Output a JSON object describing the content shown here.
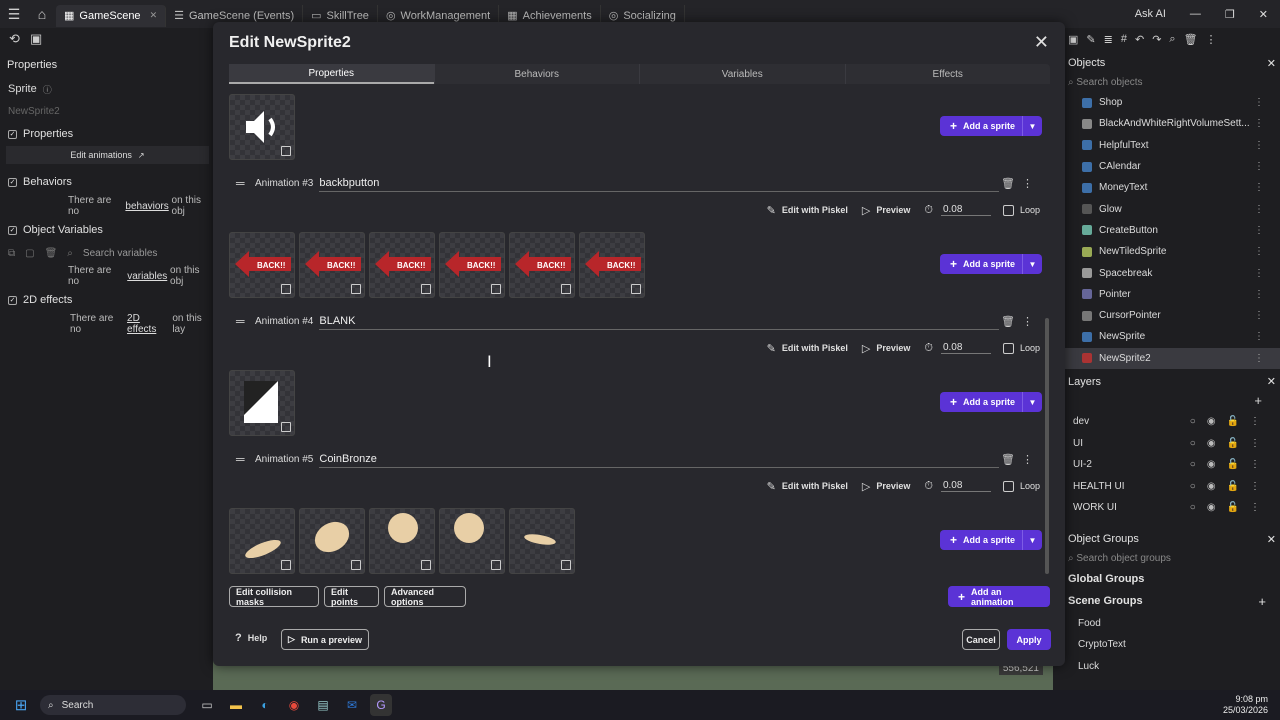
{
  "app": {
    "tabs": [
      {
        "label": "GameScene",
        "active": true
      },
      {
        "label": "GameScene (Events)"
      },
      {
        "label": "SkillTree"
      },
      {
        "label": "WorkManagement"
      },
      {
        "label": "Achievements"
      },
      {
        "label": "Socializing"
      }
    ],
    "ask_ai": "Ask AI"
  },
  "left_panel": {
    "title": "Properties",
    "object_type": "Sprite",
    "name_value": "NewSprite2",
    "sections": {
      "properties": "Properties",
      "edit_animations": "Edit animations",
      "behaviors": "Behaviors",
      "behaviors_empty_pre": "There are no",
      "behaviors_empty_link": "behaviors",
      "behaviors_empty_post": "on this obj",
      "object_variables": "Object Variables",
      "search_variables": "Search variables",
      "vars_empty_pre": "There are no",
      "vars_empty_link": "variables",
      "vars_empty_post": "on this obj",
      "effects_2d": "2D effects",
      "effects_empty_pre": "There are no",
      "effects_empty_link": "2D effects",
      "effects_empty_post": "on this lay"
    }
  },
  "right_panel": {
    "objects_title": "Objects",
    "search_objects": "Search objects",
    "objects": [
      "Shop",
      "BlackAndWhiteRightVolumeSett...",
      "HelpfulText",
      "CAlendar",
      "MoneyText",
      "Glow",
      "CreateButton",
      "NewTiledSprite",
      "Spacebreak",
      "Pointer",
      "CursorPointer",
      "NewSprite",
      "NewSprite2"
    ],
    "layers_title": "Layers",
    "layers": [
      "dev",
      "UI",
      "UI-2",
      "HEALTH UI",
      "WORK UI"
    ],
    "groups_title": "Object Groups",
    "search_groups": "Search object groups",
    "global_groups": "Global Groups",
    "scene_groups": "Scene Groups",
    "groups": [
      "Food",
      "CryptoText",
      "Luck"
    ]
  },
  "modal": {
    "title": "Edit NewSprite2",
    "tabs": [
      "Properties",
      "Behaviors",
      "Variables",
      "Effects"
    ],
    "animations": [
      {
        "label": "Animation #3",
        "name": "backbputton"
      },
      {
        "label": "Animation #4",
        "name": "BLANK"
      },
      {
        "label": "Animation #5",
        "name": "CoinBronze"
      }
    ],
    "back_text": "BACK!!",
    "edit_piskel": "Edit with Piskel",
    "preview": "Preview",
    "fps": "0.08",
    "loop": "Loop",
    "add_sprite": "Add a sprite",
    "edit_collision": "Edit collision masks",
    "edit_points": "Edit points",
    "advanced": "Advanced options",
    "add_animation": "Add an animation",
    "help": "Help",
    "run_preview": "Run a preview",
    "cancel": "Cancel",
    "apply": "Apply"
  },
  "canvas": {
    "coords": "556,521"
  },
  "taskbar": {
    "search": "Search",
    "time": "9:08 pm",
    "date": "25/03/2026"
  }
}
